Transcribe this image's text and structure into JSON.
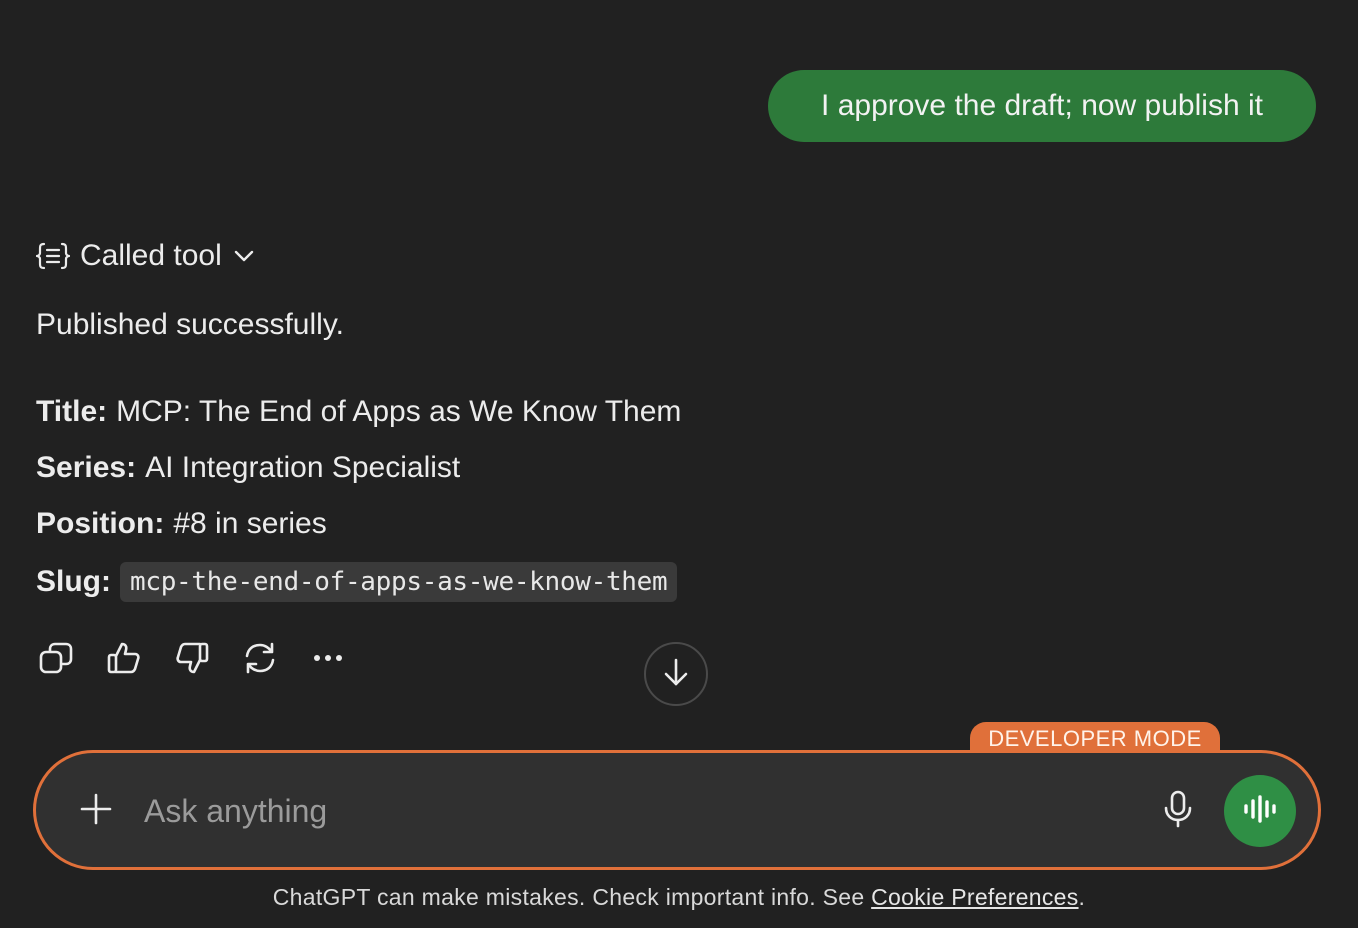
{
  "conversation": {
    "user_message": "I approve the draft; now publish it",
    "tool_call": {
      "label": "Called tool",
      "icon": "braces-list-icon",
      "chevron": "chevron-down-icon"
    },
    "assistant": {
      "status": "Published successfully.",
      "details": [
        {
          "key": "Title:",
          "value": "MCP: The End of Apps as We Know Them"
        },
        {
          "key": "Series:",
          "value": "AI Integration Specialist"
        },
        {
          "key": "Position:",
          "value": "#8 in series"
        }
      ],
      "slug": {
        "key": "Slug:",
        "value": "mcp-the-end-of-apps-as-we-know-them"
      }
    },
    "actions": [
      "copy-icon",
      "thumbs-up-icon",
      "thumbs-down-icon",
      "regenerate-icon",
      "more-icon"
    ]
  },
  "scroll_button": {
    "icon": "arrow-down-icon"
  },
  "composer": {
    "badge": "DEVELOPER MODE",
    "placeholder": "Ask anything",
    "value": "",
    "accent": "#e0703a",
    "voice_button_color": "#2f8f45"
  },
  "footer": {
    "text": "ChatGPT can make mistakes. Check important info. See ",
    "link": "Cookie Preferences",
    "suffix": "."
  },
  "colors": {
    "background": "#212121",
    "user_bubble": "#2d7a3a"
  }
}
